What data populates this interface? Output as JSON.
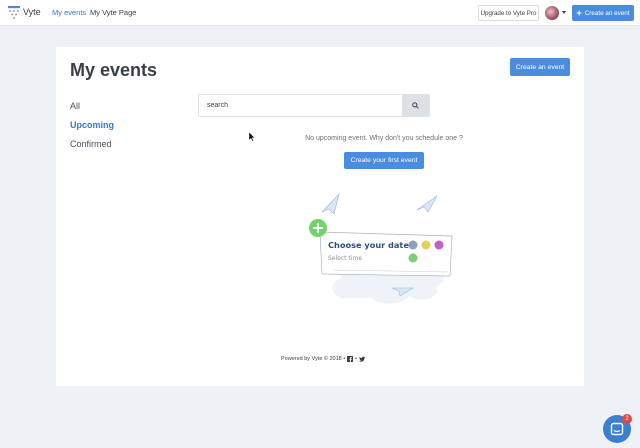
{
  "brand": {
    "name": "Vyte"
  },
  "nav": {
    "links": [
      {
        "label": "My events",
        "active": true
      },
      {
        "label": "My Vyte Page",
        "active": false
      }
    ],
    "upgrade_label": "Upgrade to Vyte Pro",
    "create_label": "Create an event"
  },
  "main": {
    "title": "My events",
    "create_label": "Create an event",
    "filters": [
      {
        "label": "All",
        "active": false
      },
      {
        "label": "Upcoming",
        "active": true
      },
      {
        "label": "Confirmed",
        "active": false
      }
    ],
    "search": {
      "placeholder": "search"
    },
    "empty_message": "No upcoming event. Why don't you schedule one ?",
    "first_event_label": "Create your first event",
    "illustration": {
      "title": "Choose your date",
      "subtitle": "Select time"
    }
  },
  "footer": {
    "text": "Powered by Vyte © 2018 •"
  },
  "chat": {
    "badge": "2"
  },
  "colors": {
    "accent": "#4a8de0",
    "active_link": "#3c78c8",
    "green": "#6fd56a"
  }
}
